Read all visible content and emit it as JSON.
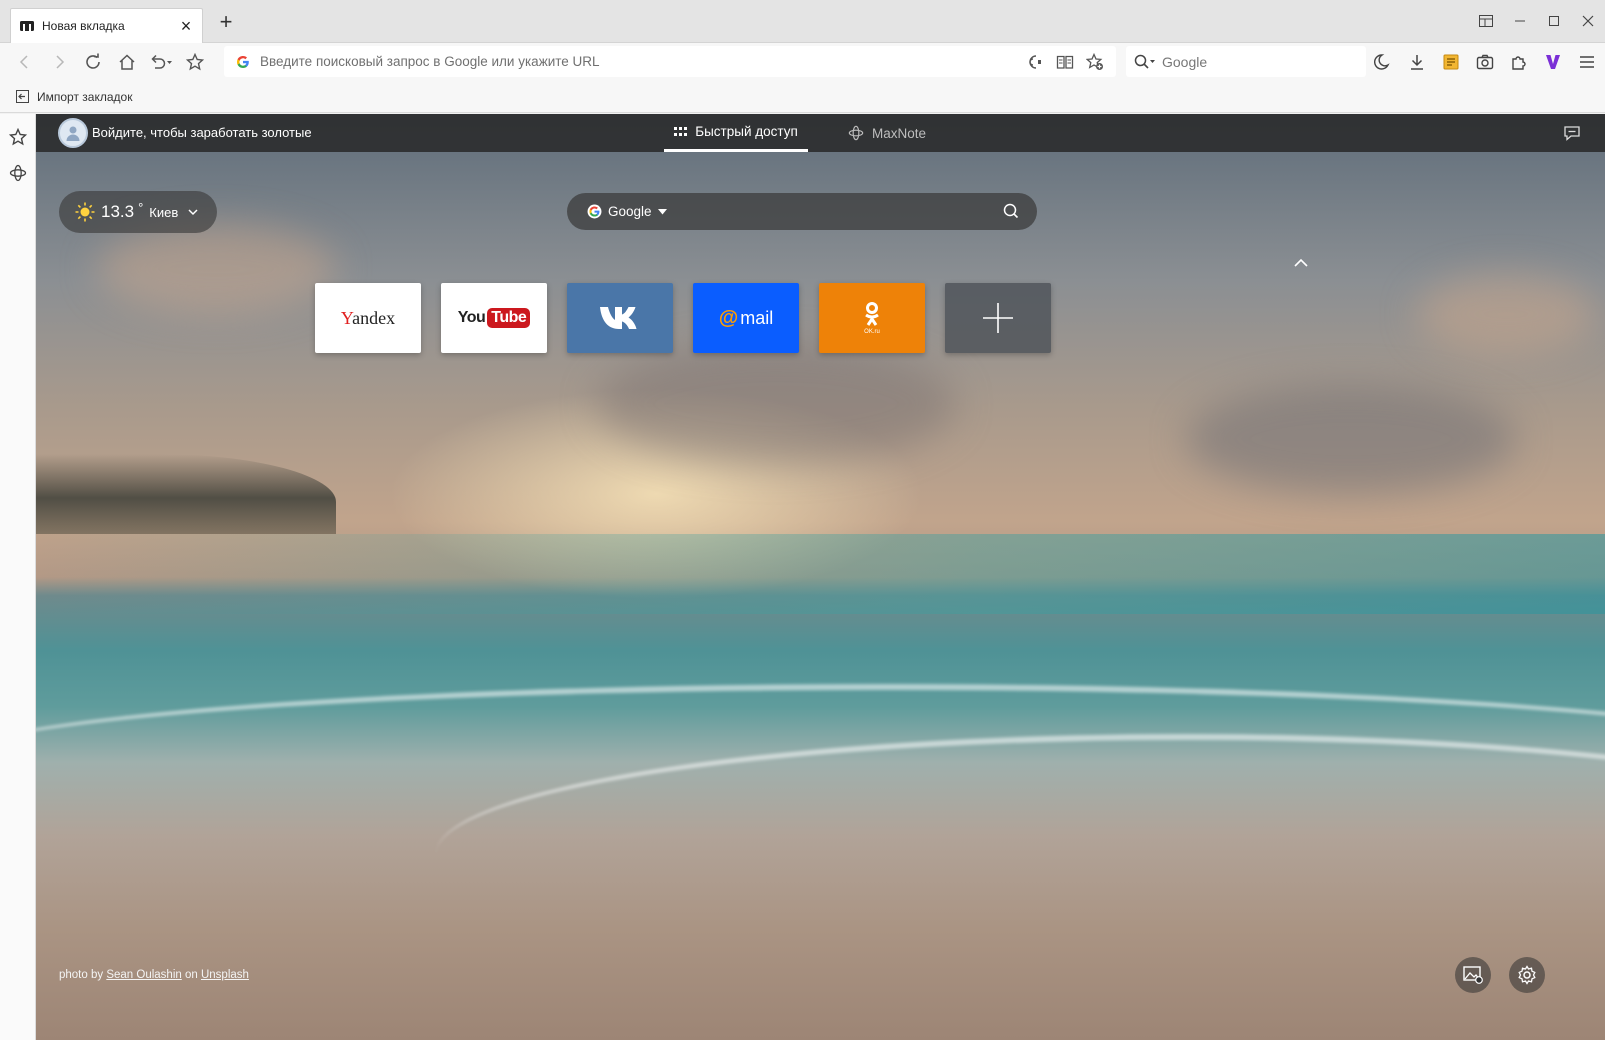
{
  "tab": {
    "title": "Новая вкладка",
    "close": "×"
  },
  "tabstrip": {
    "new_tab": "+"
  },
  "address": {
    "placeholder": "Введите поисковый запрос в Google или укажите URL"
  },
  "search": {
    "engine": "Google"
  },
  "bookmarks": {
    "import_label": "Импорт закладок"
  },
  "newtab": {
    "signin": "Войдите, чтобы заработать золотые",
    "tabs": [
      {
        "label": "Быстрый доступ"
      },
      {
        "label": "MaxNote"
      }
    ],
    "weather": {
      "temp": "13.3",
      "degree": "°",
      "city": "Киев"
    },
    "search_engine": "Google",
    "tiles": {
      "yandex": {
        "first": "Y",
        "rest": "andex"
      },
      "youtube": {
        "you": "You",
        "tube": "Tube"
      },
      "mail": {
        "at": "@",
        "word": "mail"
      },
      "ok": {
        "sub": "OK.ru"
      }
    },
    "credit": {
      "prefix": "photo by",
      "author": "Sean Oulashin",
      "on": "on",
      "site": "Unsplash"
    }
  },
  "colors": {
    "vk": "#4a76a8",
    "mail": "#0a5dff",
    "ok": "#ee8208",
    "youtube_red": "#cc181e",
    "maxthon_accent": "#7b2fd6"
  },
  "icons": [
    "maxthon-logo-icon",
    "back-icon",
    "forward-icon",
    "reload-icon",
    "home-icon",
    "undo-icon",
    "star-icon",
    "google-g-icon",
    "read-aloud-icon",
    "reader-mode-icon",
    "favorite-add-icon",
    "search-icon",
    "night-mode-icon",
    "download-icon",
    "notes-icon",
    "screenshot-icon",
    "extensions-icon",
    "maxthon-v-icon",
    "menu-icon",
    "import-icon",
    "sun-icon",
    "chat-icon",
    "grid-icon",
    "maxnote-icon",
    "wallpaper-icon",
    "settings-icon"
  ]
}
